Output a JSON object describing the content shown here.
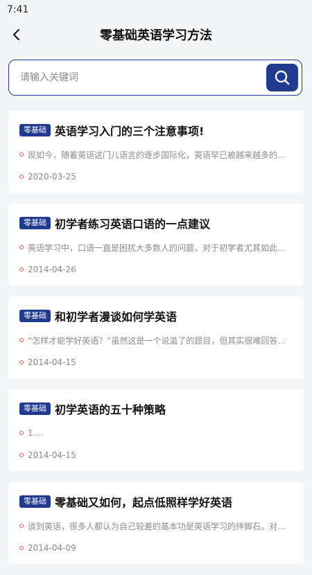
{
  "status_bar": {
    "time": "7:41"
  },
  "header": {
    "title": "零基础英语学习方法"
  },
  "search": {
    "placeholder": "请输入关键词"
  },
  "articles": [
    {
      "badge": "零基础",
      "title": "英语学习入门的三个注意事项!",
      "summary": "现如今，随着英语这门儿语言的逐步国际化，英语早已被越来越多的人...",
      "date": "2020-03-25"
    },
    {
      "badge": "零基础",
      "title": "初学者练习英语口语的一点建议",
      "summary": "英语学习中，口语一直是困扰大多数人的问题，对于初学者尤其如此。...",
      "date": "2014-04-26"
    },
    {
      "badge": "零基础",
      "title": "和初学者漫谈如何学英语",
      "summary": "“怎样才能学好英语？”虽然这是一个说滥了的题目，但其实很难回答。...",
      "date": "2014-04-15"
    },
    {
      "badge": "零基础",
      "title": "初学英语的五十种策略",
      "summary": "1....",
      "date": "2014-04-15"
    },
    {
      "badge": "零基础",
      "title": "零基础又如何，起点低照样学好英语",
      "summary": "谈到英语，很多人都认为自己较差的基本功是英语学习的绊脚石。对于...",
      "date": "2014-04-09"
    }
  ]
}
